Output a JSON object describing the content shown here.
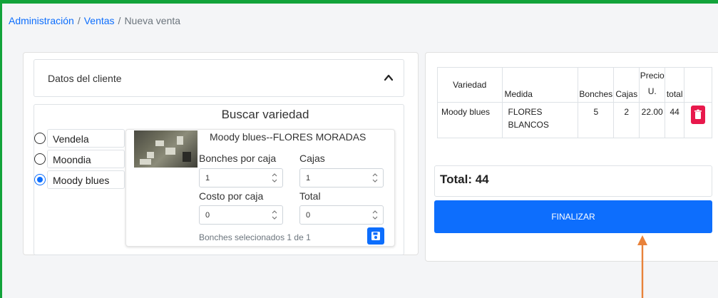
{
  "breadcrumb": {
    "item1": "Administración",
    "item2": "Ventas",
    "current": "Nueva venta",
    "separator": "/"
  },
  "accordion": {
    "title": "Datos del cliente"
  },
  "search": {
    "title": "Buscar variedad",
    "options": [
      {
        "label": "Vendela",
        "checked": false
      },
      {
        "label": "Moondia",
        "checked": false
      },
      {
        "label": "Moody blues",
        "checked": true
      }
    ]
  },
  "detail": {
    "title": "Moody blues--FLORES MORADAS",
    "bonches_label": "Bonches por caja",
    "bonches_value": "1",
    "cajas_label": "Cajas",
    "cajas_value": "1",
    "costo_label": "Costo por caja",
    "costo_value": "0",
    "total_label": "Total",
    "total_value": "0",
    "footer": "Bonches selecionados 1 de 1"
  },
  "table": {
    "headers": [
      "Variedad",
      "Medida",
      "Bonches",
      "Cajas",
      "Precio U.",
      "total"
    ],
    "rows": [
      {
        "variedad": "Moody blues",
        "medida": "FLORES BLANCOS",
        "bonches": "5",
        "cajas": "2",
        "precio": "22.00",
        "total": "44"
      }
    ]
  },
  "summary": {
    "total": "Total: 44",
    "finalizar": "FINALIZAR"
  },
  "colors": {
    "accent": "#0d6efd",
    "topbar": "#12a33a",
    "delete": "#e8194c",
    "annotation_arrow": "#e8823a"
  }
}
